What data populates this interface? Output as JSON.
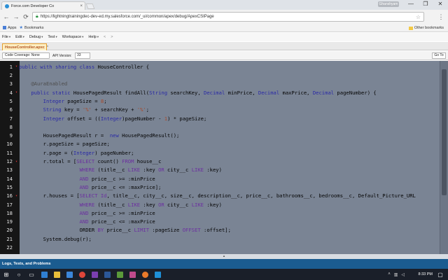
{
  "browser": {
    "tab_title": "Force.com Developer Co",
    "tab_close": "×",
    "profile_label": "Ghanshyam",
    "window_minimize": "—",
    "window_restore": "❐",
    "window_close": "✕",
    "back": "←",
    "forward": "→",
    "reload": "⟳",
    "url": "https://lightningtrainingdec-dev-ed.my.salesforce.com/_ui/common/apex/debug/ApexCSIPage",
    "bookmarks": {
      "apps": "Apps",
      "bookmarks": "Bookmarks",
      "other": "Other bookmarks"
    }
  },
  "menu": {
    "items": [
      "File",
      "Edit",
      "Debug",
      "Test",
      "Workspace",
      "Help"
    ],
    "back": "<",
    "forward": ">"
  },
  "file_tab": {
    "label": "HouseController.apxc",
    "close": "*"
  },
  "toolbar": {
    "code_coverage": "Code Coverage: None",
    "api_label": "API Version:",
    "api_value": "33",
    "goto": "Go To"
  },
  "editor": {
    "lines": [
      {
        "n": "1",
        "fold": true,
        "tokens": [
          [
            "kw",
            "public"
          ],
          [
            "p",
            " "
          ],
          [
            "kw",
            "with"
          ],
          [
            "p",
            " "
          ],
          [
            "kw",
            "sharing"
          ],
          [
            "p",
            " "
          ],
          [
            "kw",
            "class"
          ],
          [
            "p",
            " HouseController {"
          ]
        ]
      },
      {
        "n": "2",
        "fold": false,
        "tokens": []
      },
      {
        "n": "3",
        "fold": false,
        "tokens": [
          [
            "p",
            "    "
          ],
          [
            "an",
            "@AuraEnabled"
          ]
        ]
      },
      {
        "n": "4",
        "fold": true,
        "tokens": [
          [
            "p",
            "    "
          ],
          [
            "kw",
            "public"
          ],
          [
            "p",
            " "
          ],
          [
            "kw",
            "static"
          ],
          [
            "p",
            " HousePagedResult findAll("
          ],
          [
            "ty",
            "String"
          ],
          [
            "p",
            " searchKey, "
          ],
          [
            "ty",
            "Decimal"
          ],
          [
            "p",
            " minPrice, "
          ],
          [
            "ty",
            "Decimal"
          ],
          [
            "p",
            " maxPrice, "
          ],
          [
            "ty",
            "Decimal"
          ],
          [
            "p",
            " pageNumber) {"
          ]
        ]
      },
      {
        "n": "5",
        "fold": false,
        "tokens": [
          [
            "p",
            "        "
          ],
          [
            "ty",
            "Integer"
          ],
          [
            "p",
            " pageSize = "
          ],
          [
            "num",
            "8"
          ],
          [
            "p",
            ";"
          ]
        ]
      },
      {
        "n": "6",
        "fold": false,
        "tokens": [
          [
            "p",
            "        "
          ],
          [
            "ty",
            "String"
          ],
          [
            "p",
            " key = "
          ],
          [
            "str",
            "'%'"
          ],
          [
            "p",
            " + searchKey + "
          ],
          [
            "str",
            "'%'"
          ],
          [
            "p",
            ";"
          ]
        ]
      },
      {
        "n": "7",
        "fold": false,
        "tokens": [
          [
            "p",
            "        "
          ],
          [
            "ty",
            "Integer"
          ],
          [
            "p",
            " offset = (("
          ],
          [
            "ty",
            "Integer"
          ],
          [
            "p",
            ")pageNumber - "
          ],
          [
            "num",
            "1"
          ],
          [
            "p",
            ") * pageSize;"
          ]
        ]
      },
      {
        "n": "8",
        "fold": false,
        "tokens": []
      },
      {
        "n": "9",
        "fold": false,
        "tokens": [
          [
            "p",
            "        HousePagedResult r =  "
          ],
          [
            "kw",
            "new"
          ],
          [
            "p",
            " HousePagedResult();"
          ]
        ]
      },
      {
        "n": "10",
        "fold": false,
        "tokens": [
          [
            "p",
            "        r.pageSize = pageSize;"
          ]
        ]
      },
      {
        "n": "11",
        "fold": false,
        "tokens": [
          [
            "p",
            "        r.page = ("
          ],
          [
            "ty",
            "Integer"
          ],
          [
            "p",
            ") pageNumber;"
          ]
        ]
      },
      {
        "n": "12",
        "fold": true,
        "tokens": [
          [
            "p",
            "        r.total = ["
          ],
          [
            "sq1",
            "SELECT"
          ],
          [
            "p",
            " count() "
          ],
          [
            "sq1",
            "FROM"
          ],
          [
            "p",
            " house__c"
          ]
        ]
      },
      {
        "n": "13",
        "fold": false,
        "tokens": [
          [
            "p",
            "                    "
          ],
          [
            "sq1",
            "WHERE"
          ],
          [
            "p",
            " (title__c "
          ],
          [
            "sq1",
            "LIKE"
          ],
          [
            "p",
            " :key "
          ],
          [
            "sq1",
            "OR"
          ],
          [
            "p",
            " city__c "
          ],
          [
            "sq1",
            "LIKE"
          ],
          [
            "p",
            " :key)"
          ]
        ]
      },
      {
        "n": "14",
        "fold": false,
        "tokens": [
          [
            "p",
            "                    "
          ],
          [
            "sq1",
            "AND"
          ],
          [
            "p",
            " price__c >= :minPrice"
          ]
        ]
      },
      {
        "n": "15",
        "fold": false,
        "tokens": [
          [
            "p",
            "                    "
          ],
          [
            "sq1",
            "AND"
          ],
          [
            "p",
            " price__c <= :maxPrice];"
          ]
        ]
      },
      {
        "n": "16",
        "fold": true,
        "tokens": [
          [
            "p",
            "        r.houses = ["
          ],
          [
            "sq1",
            "SELECT"
          ],
          [
            "p",
            " "
          ],
          [
            "sq1",
            "Id"
          ],
          [
            "p",
            ", title__c, city__c, size__c, description__c, price__c, bathrooms__c, bedrooms__c, Default_Picture_URL"
          ]
        ]
      },
      {
        "n": "17",
        "fold": false,
        "tokens": [
          [
            "p",
            "                    "
          ],
          [
            "sq1",
            "WHERE"
          ],
          [
            "p",
            " (title__c "
          ],
          [
            "sq1",
            "LIKE"
          ],
          [
            "p",
            " :key "
          ],
          [
            "sq1",
            "OR"
          ],
          [
            "p",
            " city__c "
          ],
          [
            "sq1",
            "LIKE"
          ],
          [
            "p",
            " :key)"
          ]
        ]
      },
      {
        "n": "18",
        "fold": false,
        "tokens": [
          [
            "p",
            "                    "
          ],
          [
            "sq1",
            "AND"
          ],
          [
            "p",
            " price__c >= :minPrice"
          ]
        ]
      },
      {
        "n": "19",
        "fold": false,
        "tokens": [
          [
            "p",
            "                    "
          ],
          [
            "sq1",
            "AND"
          ],
          [
            "p",
            " price__c <= :maxPrice"
          ]
        ]
      },
      {
        "n": "20",
        "fold": false,
        "tokens": [
          [
            "p",
            "                    ORDER "
          ],
          [
            "sq1",
            "BY"
          ],
          [
            "p",
            " price__c "
          ],
          [
            "sq1",
            "LIMIT"
          ],
          [
            "p",
            " :pageSize "
          ],
          [
            "sq1",
            "OFFSET"
          ],
          [
            "p",
            " :offset];"
          ]
        ]
      },
      {
        "n": "21",
        "fold": false,
        "tokens": [
          [
            "p",
            "        System.debug(r);"
          ]
        ]
      },
      {
        "n": "22",
        "fold": false,
        "tokens": []
      }
    ]
  },
  "panel": {
    "logs_label": "Logs, Tests, and Problems",
    "splitter_glyph": "▴"
  },
  "taskbar": {
    "time": "8:33 PM"
  },
  "colors": {
    "editor_bg": "#7a8494",
    "gutter_bg": "#161616",
    "logs_bg": "#1b5c90",
    "accent_tab": "#e49c2e"
  }
}
